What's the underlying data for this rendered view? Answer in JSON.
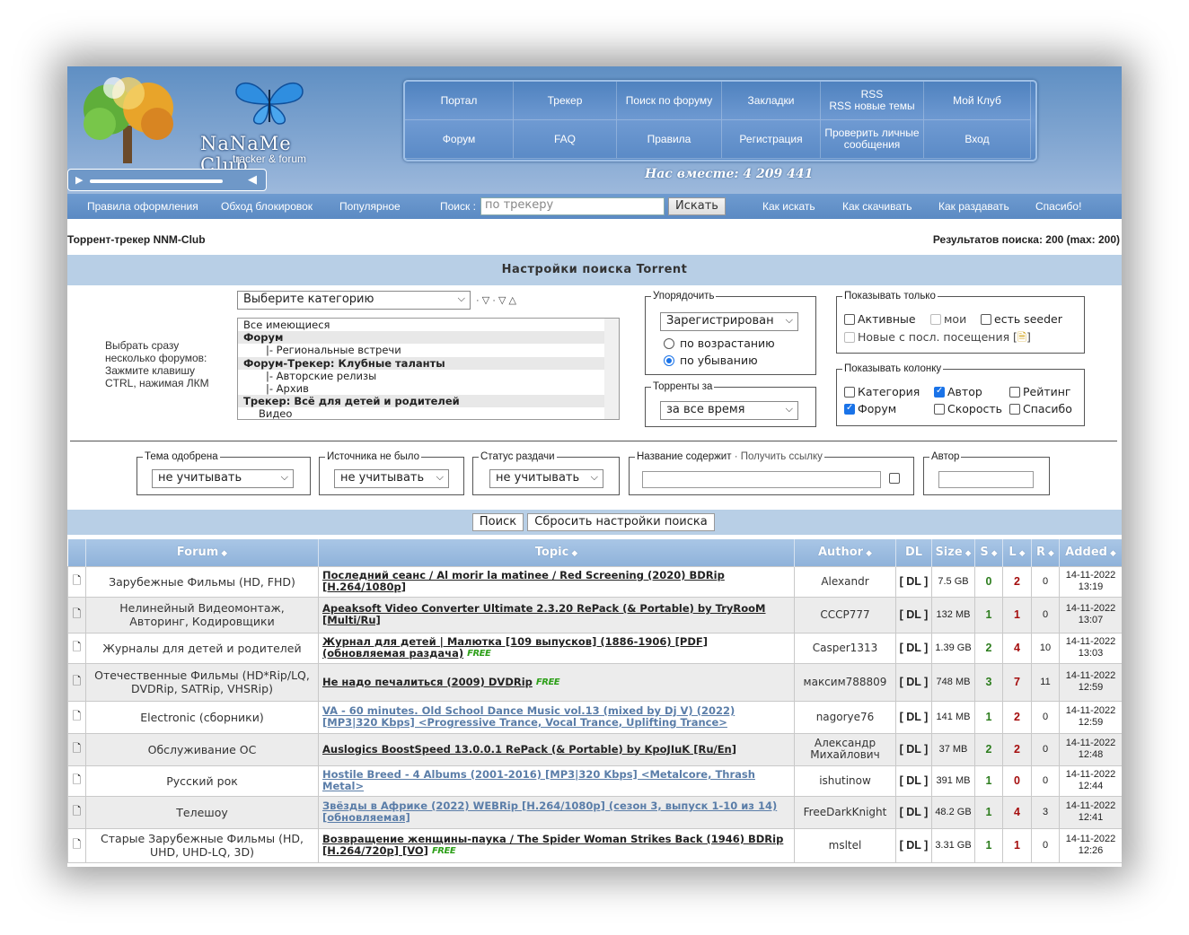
{
  "header": {
    "brand": "NaNaMe Club",
    "brand_sub": "tracker & forum",
    "online": "Нас вместе: 4 209 441",
    "nav": [
      {
        "label": "Портал"
      },
      {
        "label": "Трекер"
      },
      {
        "label": "Поиск по форуму"
      },
      {
        "label": "Закладки"
      },
      {
        "label": "RSS\nRSS новые темы"
      },
      {
        "label": "Мой Клуб"
      },
      {
        "label": "Форум"
      },
      {
        "label": "FAQ"
      },
      {
        "label": "Правила"
      },
      {
        "label": "Регистрация"
      },
      {
        "label": "Проверить личные сообщения"
      },
      {
        "label": "Вход"
      }
    ]
  },
  "subnav": {
    "links": [
      "Правила оформления",
      "Обход блокировок",
      "Популярное"
    ],
    "search_label": "Поиск :",
    "search_placeholder": "по трекеру",
    "search_button": "Искать",
    "right_links": [
      "Как искать",
      "Как скачивать",
      "Как раздавать",
      "Спасибо!"
    ]
  },
  "page": {
    "title": "Торрент-трекер NNM-Club",
    "results": "Результатов поиска: 200 (max: 200)"
  },
  "settings": {
    "heading": "Настройки поиска Torrent",
    "hint": "Выбрать сразу несколько форумов: Зажмите клавишу CTRL, нажимая ЛКМ",
    "category_select": "Выберите категорию",
    "category_marks": "· ▽ · ▽ △",
    "forum_list": [
      {
        "label": "Все имеющиеся",
        "group": false
      },
      {
        "label": "Форум",
        "group": true
      },
      {
        "label": "   |- Региональные встречи",
        "group": false
      },
      {
        "label": "Форум-Трекер: Клубные таланты",
        "group": true
      },
      {
        "label": "   |- Авторские релизы",
        "group": false
      },
      {
        "label": "   |- Архив",
        "group": false
      },
      {
        "label": "Трекер: Всё для детей и родителей",
        "group": true
      },
      {
        "label": "   Видео",
        "group": false
      }
    ],
    "sort": {
      "legend": "Упорядочить",
      "value": "Зарегистрирован",
      "asc": "по возрастанию",
      "desc": "по убыванию"
    },
    "period": {
      "legend": "Торренты за",
      "value": "за все время"
    },
    "show_only": {
      "legend": "Показывать только",
      "active": "Активные",
      "mine": "мои",
      "seeder": "есть seeder",
      "new": "Новые с посл. посещения ["
    },
    "columns": {
      "legend": "Показывать колонку",
      "category": "Категория",
      "author": "Автор",
      "rating": "Рейтинг",
      "forum": "Форум",
      "speed": "Скорость",
      "thanks": "Спасибо"
    },
    "approved": {
      "legend": "Тема одобрена",
      "value": "не учитывать"
    },
    "no_source": {
      "legend": "Источника не было",
      "value": "не учитывать"
    },
    "status": {
      "legend": "Статус раздачи",
      "value": "не учитывать"
    },
    "name_contains": {
      "legend": "Название содержит",
      "link": "· Получить ссылку"
    },
    "author": {
      "legend": "Автор"
    },
    "search_button": "Поиск",
    "reset_button": "Сбросить настройки поиска"
  },
  "table": {
    "headers": [
      "Forum",
      "Topic",
      "Author",
      "DL",
      "Size",
      "S",
      "L",
      "R",
      "Added"
    ],
    "free_label": "FREE",
    "rows": [
      {
        "forum": "Зарубежные Фильмы (HD, FHD)",
        "topic": "Последний сеанс / Al morir la matinee / Red Screening (2020) BDRip [H.264/1080p]",
        "author": "Alexandr",
        "dl": "[ DL ]",
        "size": "7.5 GB",
        "s": "0",
        "l": "2",
        "r": "0",
        "date": "14-11-2022",
        "time": "13:19",
        "free": false,
        "seen": false
      },
      {
        "forum": "Нелинейный Видеомонтаж, Авторинг, Кодировщики",
        "topic": "Apeaksoft Video Converter Ultimate 2.3.20 RePack (& Portable) by TryRooM [Multi/Ru]",
        "author": "CCCP777",
        "dl": "[ DL ]",
        "size": "132 MB",
        "s": "1",
        "l": "1",
        "r": "0",
        "date": "14-11-2022",
        "time": "13:07",
        "free": false,
        "seen": false
      },
      {
        "forum": "Журналы для детей и родителей",
        "topic": "Журнал для детей | Малютка [109 выпусков] (1886-1906) [PDF] (обновляемая раздача)",
        "author": "Casper1313",
        "dl": "[ DL ]",
        "size": "1.39 GB",
        "s": "2",
        "l": "4",
        "r": "10",
        "date": "14-11-2022",
        "time": "13:03",
        "free": true,
        "seen": false
      },
      {
        "forum": "Отечественные Фильмы (HD*Rip/LQ, DVDRip, SATRip, VHSRip)",
        "topic": "Не надо печалиться (2009) DVDRip",
        "author": "максим788809",
        "dl": "[ DL ]",
        "size": "748 MB",
        "s": "3",
        "l": "7",
        "r": "11",
        "date": "14-11-2022",
        "time": "12:59",
        "free": true,
        "seen": false
      },
      {
        "forum": "Electronic (сборники)",
        "topic": "VA - 60 minutes. Old School Dance Music vol.13 (mixed by Dj V) (2022) [MP3|320 Kbps] <Progressive Trance, Vocal Trance, Uplifting Trance>",
        "author": "nagorye76",
        "dl": "[ DL ]",
        "size": "141 MB",
        "s": "1",
        "l": "2",
        "r": "0",
        "date": "14-11-2022",
        "time": "12:59",
        "free": false,
        "seen": true
      },
      {
        "forum": "Обслуживание ОС",
        "topic": "Auslogics BoostSpeed 13.0.0.1 RePack (& Portable) by KpoJIuK [Ru/En]",
        "author": "Александр Михайлович",
        "dl": "[ DL ]",
        "size": "37 MB",
        "s": "2",
        "l": "2",
        "r": "0",
        "date": "14-11-2022",
        "time": "12:48",
        "free": false,
        "seen": false
      },
      {
        "forum": "Русский рок",
        "topic": "Hostile Breed - 4 Albums (2001-2016) [MP3|320 Kbps] <Metalcore, Thrash Metal>",
        "author": "ishutinow",
        "dl": "[ DL ]",
        "size": "391 MB",
        "s": "1",
        "l": "0",
        "r": "0",
        "date": "14-11-2022",
        "time": "12:44",
        "free": false,
        "seen": true
      },
      {
        "forum": "Телешоу",
        "topic": "Звёзды в Африке (2022) WEBRip [H.264/1080p] (сезон 3, выпуск 1-10 из 14) [обновляемая]",
        "author": "FreeDarkKnight",
        "dl": "[ DL ]",
        "size": "48.2 GB",
        "s": "1",
        "l": "4",
        "r": "3",
        "date": "14-11-2022",
        "time": "12:41",
        "free": false,
        "seen": true
      },
      {
        "forum": "Старые Зарубежные Фильмы (HD, UHD, UHD-LQ, 3D)",
        "topic": "Возвращение женщины-паука / The Spider Woman Strikes Back (1946) BDRip [H.264/720p] [VO]",
        "author": "msltel",
        "dl": "[ DL ]",
        "size": "3.31 GB",
        "s": "1",
        "l": "1",
        "r": "0",
        "date": "14-11-2022",
        "time": "12:26",
        "free": true,
        "seen": false
      }
    ]
  }
}
